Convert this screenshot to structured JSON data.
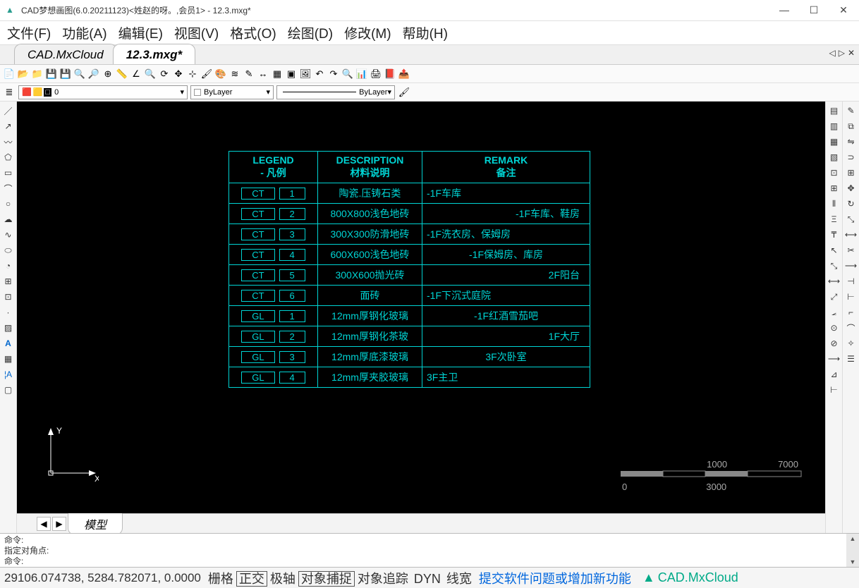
{
  "window": {
    "title": "CAD梦想画图(6.0.20211123)<姓赵的呀。,会员1> - 12.3.mxg*",
    "min": "—",
    "max": "☐",
    "close": "✕"
  },
  "menubar": [
    "文件(F)",
    "功能(A)",
    "编辑(E)",
    "视图(V)",
    "格式(O)",
    "绘图(D)",
    "修改(M)",
    "帮助(H)"
  ],
  "tabs": [
    {
      "label": "CAD.MxCloud",
      "active": false
    },
    {
      "label": "12.3.mxg*",
      "active": true
    }
  ],
  "layer": {
    "current": "0",
    "bylayer": "ByLayer",
    "linetype": "ByLayer"
  },
  "table": {
    "header": [
      {
        "l1": "LEGEND",
        "l2": "- 凡例"
      },
      {
        "l1": "DESCRIPTION",
        "l2": "材料说明"
      },
      {
        "l1": "REMARK",
        "l2": "备注"
      }
    ],
    "rows": [
      {
        "code": "CT",
        "num": "1",
        "desc": "陶瓷.压铸石类",
        "remark": "-1F车库",
        "align": "l"
      },
      {
        "code": "CT",
        "num": "2",
        "desc": "800X800浅色地砖",
        "remark": "-1F车库、鞋房",
        "align": "r"
      },
      {
        "code": "CT",
        "num": "3",
        "desc": "300X300防滑地砖",
        "remark": "-1F洗衣房、保姆房",
        "align": "l"
      },
      {
        "code": "CT",
        "num": "4",
        "desc": "600X600浅色地砖",
        "remark": "-1F保姆房、库房",
        "align": "c"
      },
      {
        "code": "CT",
        "num": "5",
        "desc": "300X600抛光砖",
        "remark": "2F阳台",
        "align": "r"
      },
      {
        "code": "CT",
        "num": "6",
        "desc": "面砖",
        "remark": "-1F下沉式庭院",
        "align": "l"
      },
      {
        "code": "GL",
        "num": "1",
        "desc": "12mm厚钢化玻璃",
        "remark": "-1F红酒雪茄吧",
        "align": "c"
      },
      {
        "code": "GL",
        "num": "2",
        "desc": "12mm厚钢化茶玻",
        "remark": "1F大厅",
        "align": "r"
      },
      {
        "code": "GL",
        "num": "3",
        "desc": "12mm厚底漆玻璃",
        "remark": "3F次卧室",
        "align": "c"
      },
      {
        "code": "GL",
        "num": "4",
        "desc": "12mm厚夹胶玻璃",
        "remark": "3F主卫",
        "align": "l"
      }
    ]
  },
  "ucs": {
    "x": "X",
    "y": "Y"
  },
  "scale": {
    "t0": "0",
    "t1": "1000",
    "t2": "3000",
    "t3": "7000"
  },
  "model_tab": "模型",
  "cmd": {
    "line1": "命令:",
    "line2": "指定对角点:",
    "line3": "命令:"
  },
  "status": {
    "coords": "29106.074738, 5284.782071, 0.0000",
    "btns": [
      {
        "label": "栅格",
        "on": false
      },
      {
        "label": "正交",
        "on": true
      },
      {
        "label": "极轴",
        "on": false
      },
      {
        "label": "对象捕捉",
        "on": true
      },
      {
        "label": "对象追踪",
        "on": false
      },
      {
        "label": "DYN",
        "on": false
      },
      {
        "label": "线宽",
        "on": false
      }
    ],
    "link": "提交软件问题或增加新功能",
    "brand": "CAD.MxCloud"
  }
}
